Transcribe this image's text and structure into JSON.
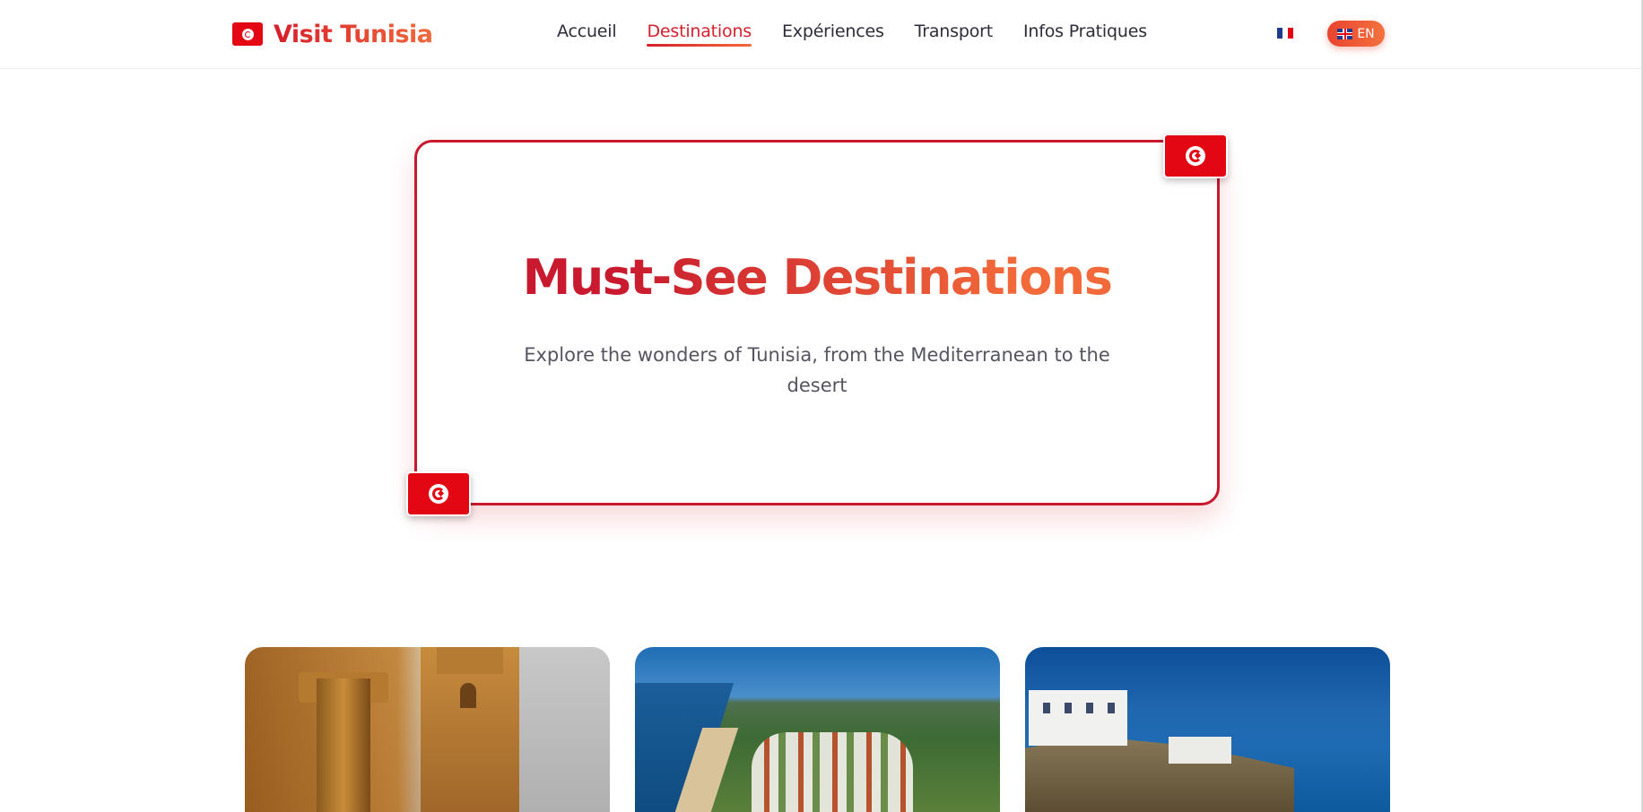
{
  "brand": {
    "title": "Visit Tunisia",
    "flag_icon": "tunisia-flag-icon",
    "flag_color": "#e30613"
  },
  "nav": {
    "items": [
      {
        "label": "Accueil",
        "active": false
      },
      {
        "label": "Destinations",
        "active": true
      },
      {
        "label": "Expériences",
        "active": false
      },
      {
        "label": "Transport",
        "active": false
      },
      {
        "label": "Infos Pratiques",
        "active": false
      }
    ]
  },
  "language": {
    "alt_flag_icon": "france-flag-icon",
    "current_label": "EN",
    "current_flag_icon": "uk-flag-icon"
  },
  "hero": {
    "title": "Must-See Destinations",
    "subtitle": "Explore the wonders of Tunisia, from the Mediterranean to the desert",
    "badge_icon": "tunisia-flag-icon"
  },
  "colors": {
    "accent_red": "#c8192e",
    "accent_orange": "#f26a3a",
    "text_dark": "#2d2d3a",
    "text_muted": "#555561"
  },
  "cards": [
    {
      "image": "kairouan-mosque-minaret-photo"
    },
    {
      "image": "coastal-resort-aerial-photo"
    },
    {
      "image": "cliffside-white-village-sea-photo"
    }
  ]
}
